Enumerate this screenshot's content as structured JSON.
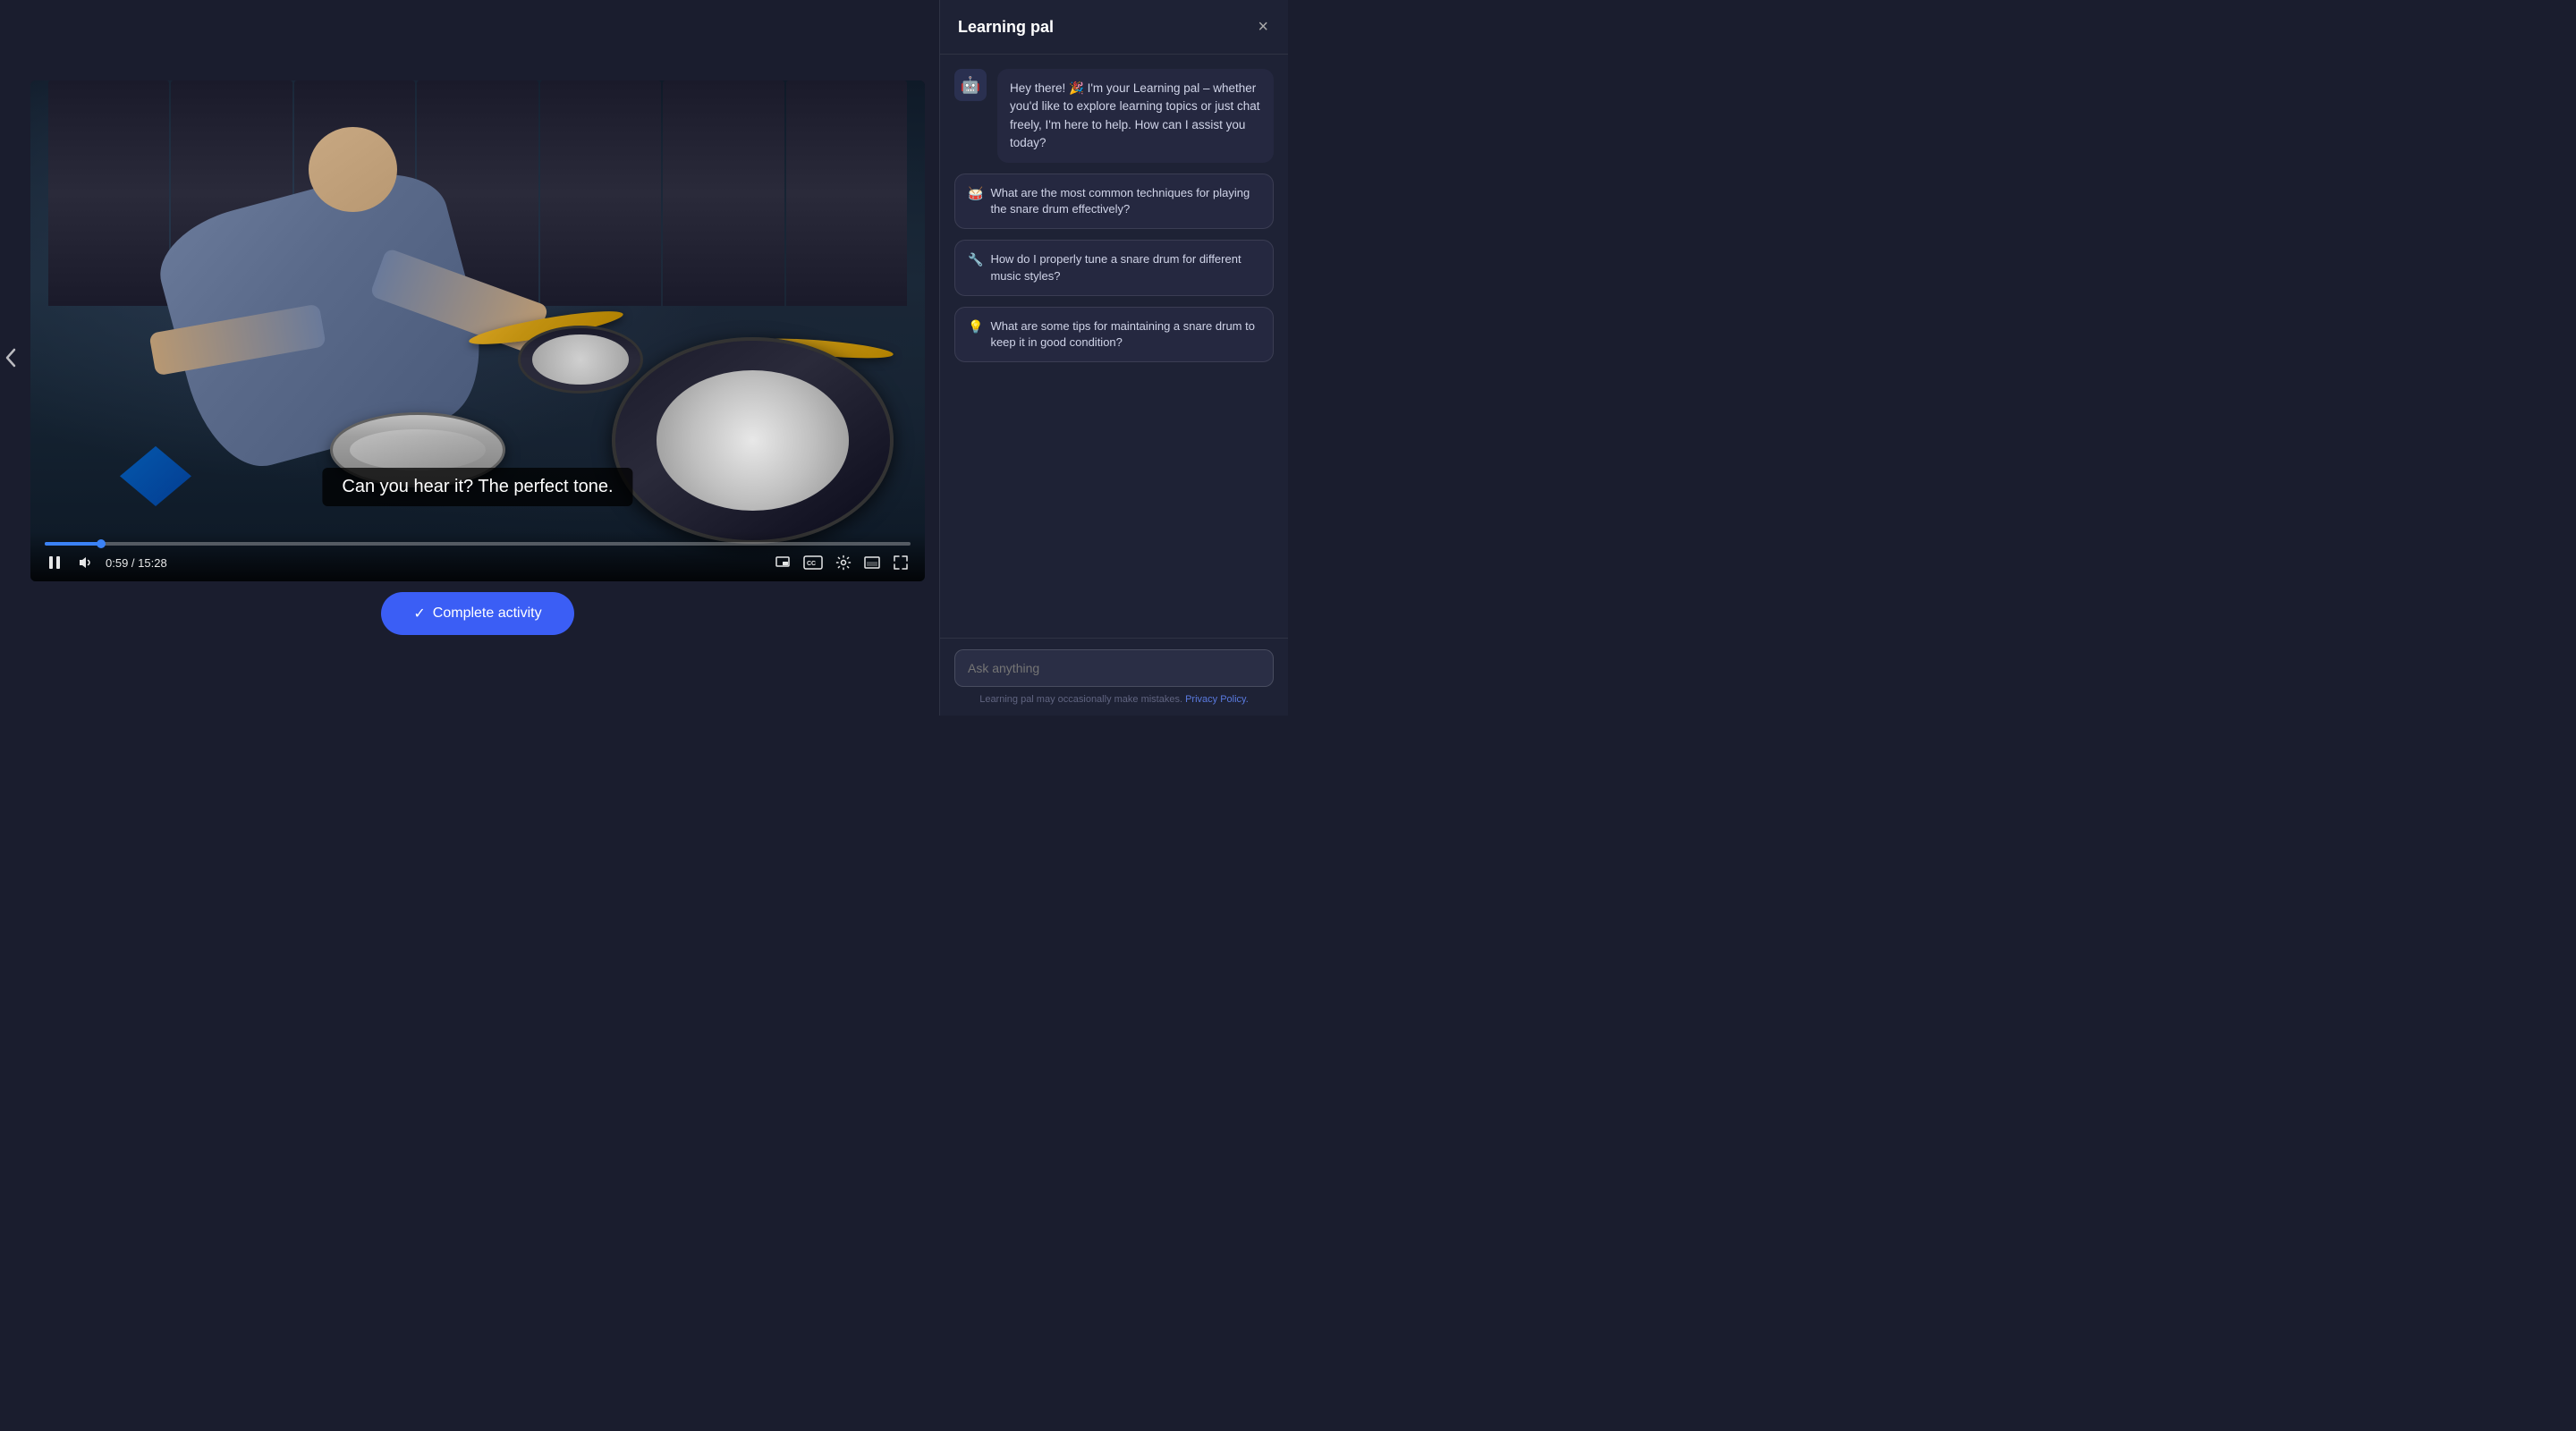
{
  "nav": {
    "back_arrow": "‹"
  },
  "video": {
    "subtitle": "Can you hear it? The perfect tone.",
    "time_current": "0:59",
    "time_total": "15:28",
    "time_display": "0:59 / 15:28",
    "progress_percent": 6.5
  },
  "controls": {
    "play_pause": "pause",
    "volume": "volume",
    "miniplayer": "miniplayer",
    "captions": "CC",
    "settings": "settings",
    "theater": "theater",
    "fullscreen": "fullscreen"
  },
  "complete_button": {
    "label": "Complete activity",
    "check_icon": "✓"
  },
  "learning_pal": {
    "title": "Learning pal",
    "bot_message": "Hey there! 🎉 I'm your Learning pal – whether you'd like to explore learning topics or just chat freely, I'm here to help. How can I assist you today?",
    "suggestions": [
      {
        "icon": "🥁",
        "text": "What are the most common techniques for playing the snare drum effectively?"
      },
      {
        "icon": "🔧",
        "text": "How do I properly tune a snare drum for different music styles?"
      },
      {
        "icon": "💡",
        "text": "What are some tips for maintaining a snare drum to keep it in good condition?"
      }
    ],
    "input_placeholder": "Ask anything",
    "disclaimer": "Learning pal may occasionally make mistakes.",
    "privacy_text": "Privacy Policy.",
    "close_label": "×"
  }
}
